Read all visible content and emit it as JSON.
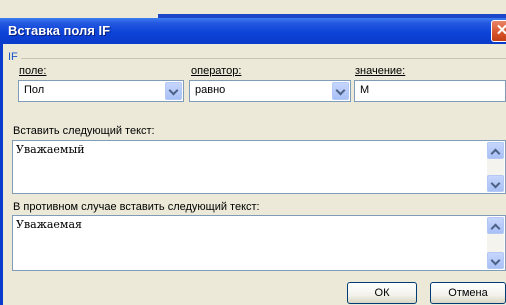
{
  "dialog": {
    "title": "Вставка поля IF",
    "close_glyph": "✕",
    "group_label": "IF"
  },
  "condition": {
    "field": {
      "label": "поле:",
      "value": "Пол",
      "icon": "chevron-down-icon"
    },
    "operator": {
      "label": "оператор:",
      "value": "равно",
      "icon": "chevron-down-icon"
    },
    "value": {
      "label": "значение:",
      "value": "М"
    }
  },
  "true_text": {
    "label": "Вставить следующий текст:",
    "value": "Уважаемый"
  },
  "false_text": {
    "label": "В противном случае вставить следующий текст:",
    "value": "Уважаемая"
  },
  "buttons": {
    "ok": "ОК",
    "cancel": "Отмена"
  },
  "colors": {
    "titlebar": "#0c43d8",
    "group_label": "#1a57c8",
    "field_border": "#7f9db9"
  }
}
